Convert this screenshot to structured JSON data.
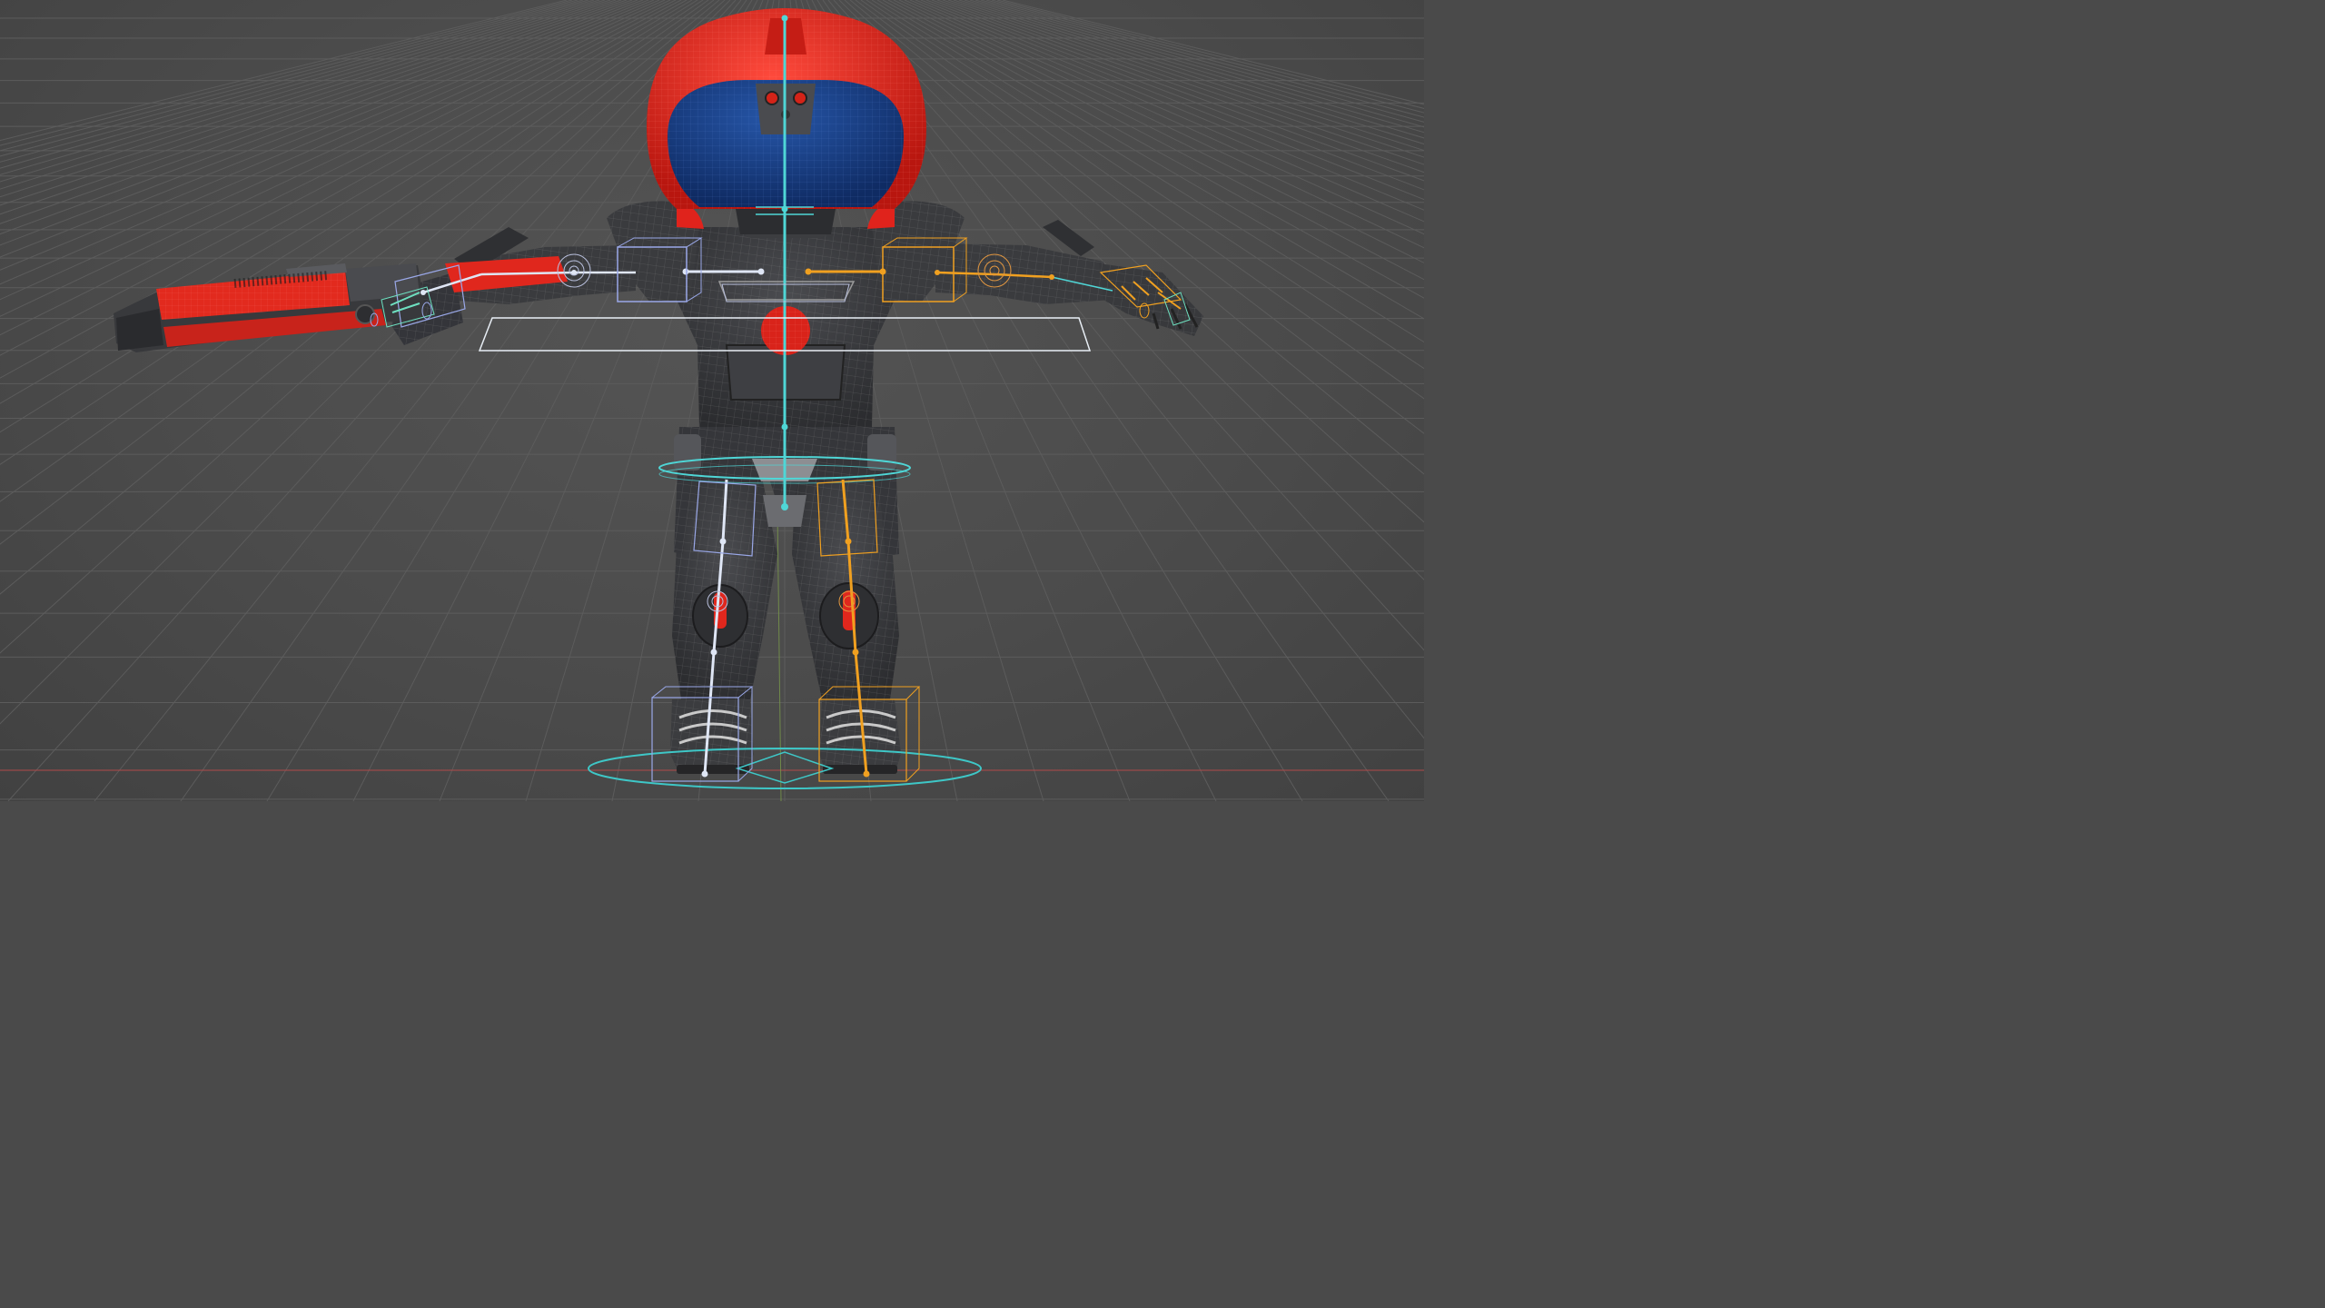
{
  "viewport": {
    "background": "#4b4b4b",
    "grid_color": "#5c5c5c",
    "x_axis_color": "#b04a4a",
    "y_axis_color": "#7a9a4a"
  },
  "model": {
    "armor_color": "#3a3b3e",
    "helmet_color": "#e0231c",
    "visor_color": "#173f86",
    "accent_color": "#e02a1e",
    "wireframe_color": "#8a8a8a"
  },
  "rig": {
    "center_bone_color": "#4fd6d6",
    "left_side_color": "#dfe6f5",
    "right_side_color": "#f0a020",
    "control_color": "#9aa8e8",
    "root_control_color": "#3ec7c7"
  },
  "icons": [
    "cube-control-icon",
    "circle-control-icon",
    "bone-icon"
  ]
}
